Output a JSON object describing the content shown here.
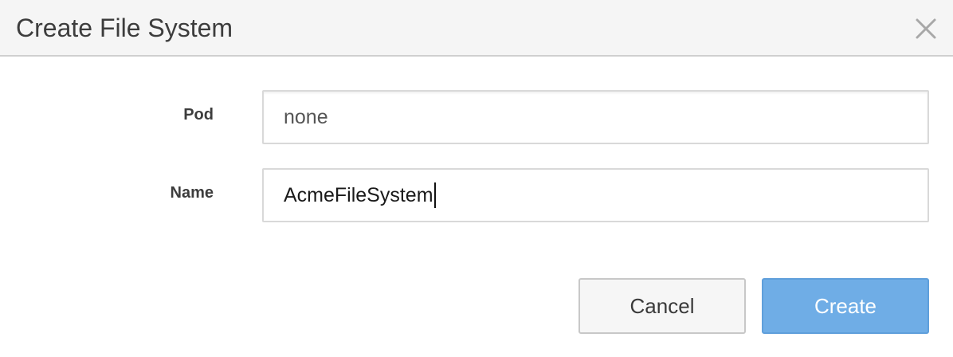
{
  "dialog": {
    "title": "Create File System",
    "close_icon": "close-icon"
  },
  "form": {
    "pod": {
      "label": "Pod",
      "value": "none"
    },
    "name": {
      "label": "Name",
      "value": "AcmeFileSystem"
    }
  },
  "actions": {
    "cancel_label": "Cancel",
    "create_label": "Create"
  },
  "colors": {
    "primary": "#6fade6",
    "header_bg": "#f5f5f5"
  }
}
